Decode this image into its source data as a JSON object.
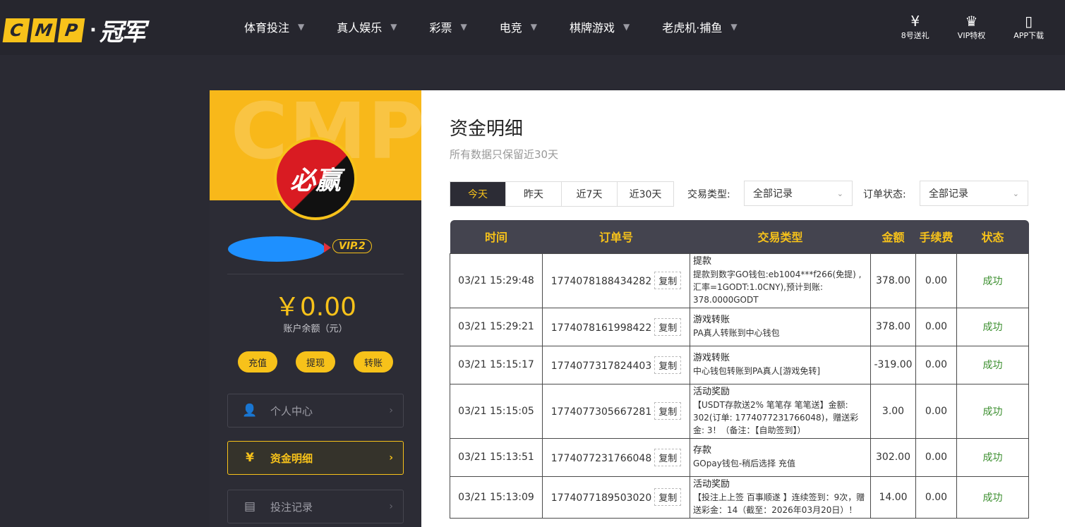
{
  "brand": {
    "logo_letters": [
      "C",
      "M",
      "P"
    ],
    "dot": "·",
    "name": "冠军"
  },
  "nav": {
    "items": [
      {
        "label": "体育投注"
      },
      {
        "label": "真人娱乐"
      },
      {
        "label": "彩票"
      },
      {
        "label": "电竞"
      },
      {
        "label": "棋牌游戏"
      },
      {
        "label": "老虎机·捕鱼"
      }
    ],
    "right": [
      {
        "label": "8号送礼",
        "icon": "ticket-icon"
      },
      {
        "label": "VIP特权",
        "icon": "crown-icon"
      },
      {
        "label": "APP下载",
        "icon": "phone-icon"
      }
    ]
  },
  "sidebar": {
    "watermark": "CMP",
    "avatar_text": "必赢",
    "vip": "VIP.2",
    "balance": "￥0.00",
    "balance_label": "账户余额（元）",
    "buttons": [
      {
        "label": "充值"
      },
      {
        "label": "提现"
      },
      {
        "label": "转账"
      }
    ],
    "menu": [
      {
        "label": "个人中心",
        "icon": "user-icon"
      },
      {
        "label": "资金明细",
        "icon": "yen-circle-icon",
        "active": true
      },
      {
        "label": "投注记录",
        "icon": "record-icon"
      }
    ]
  },
  "main": {
    "title": "资金明细",
    "subtitle": "所有数据只保留近30天",
    "tabs": [
      {
        "label": "今天"
      },
      {
        "label": "昨天"
      },
      {
        "label": "近7天"
      },
      {
        "label": "近30天"
      }
    ],
    "filters": {
      "type_label": "交易类型:",
      "type_value": "全部记录",
      "status_label": "订单状态:",
      "status_value": "全部记录"
    },
    "table": {
      "headers": [
        "时间",
        "订单号",
        "交易类型",
        "金额",
        "手续费",
        "状态"
      ],
      "copy_label": "复制",
      "rows": [
        {
          "time": "03/21 15:29:48",
          "order": "1774078188434282",
          "type_title": "提款",
          "type_desc": "提款到数字GO钱包:eb1004***f266(免提) ,汇率=1GODT:1.0CNY),预计到账: 378.0000GODT",
          "amount": "378.00",
          "fee": "0.00",
          "status": "成功"
        },
        {
          "time": "03/21 15:29:21",
          "order": "1774078161998422",
          "type_title": "游戏转账",
          "type_desc": "PA真人转账到中心钱包",
          "amount": "378.00",
          "fee": "0.00",
          "status": "成功"
        },
        {
          "time": "03/21 15:15:17",
          "order": "1774077317824403",
          "type_title": "游戏转账",
          "type_desc": "中心钱包转账到PA真人[游戏免转]",
          "amount": "-319.00",
          "fee": "0.00",
          "status": "成功"
        },
        {
          "time": "03/21 15:15:05",
          "order": "1774077305667281",
          "type_title": "活动奖励",
          "type_desc": "【USDT存款送2% 笔笔存 笔笔送】金额: 302(订单: 1774077231766048)，赠送彩金: 3！（备注：【自助签到】）",
          "amount": "3.00",
          "fee": "0.00",
          "status": "成功"
        },
        {
          "time": "03/21 15:13:51",
          "order": "1774077231766048",
          "type_title": "存款",
          "type_desc": "GOpay钱包-稍后选择 充值",
          "amount": "302.00",
          "fee": "0.00",
          "status": "成功"
        },
        {
          "time": "03/21 15:13:09",
          "order": "1774077189503020",
          "type_title": "活动奖励",
          "type_desc": "【投注上上签 百事顺遂 】连续签到：9次，赠送彩金：14（截至：2026年03月20日）！",
          "amount": "14.00",
          "fee": "0.00",
          "status": "成功"
        }
      ]
    }
  },
  "colors": {
    "accent": "#f7c21a",
    "dark": "#26262e",
    "success": "#3c8f2f"
  }
}
